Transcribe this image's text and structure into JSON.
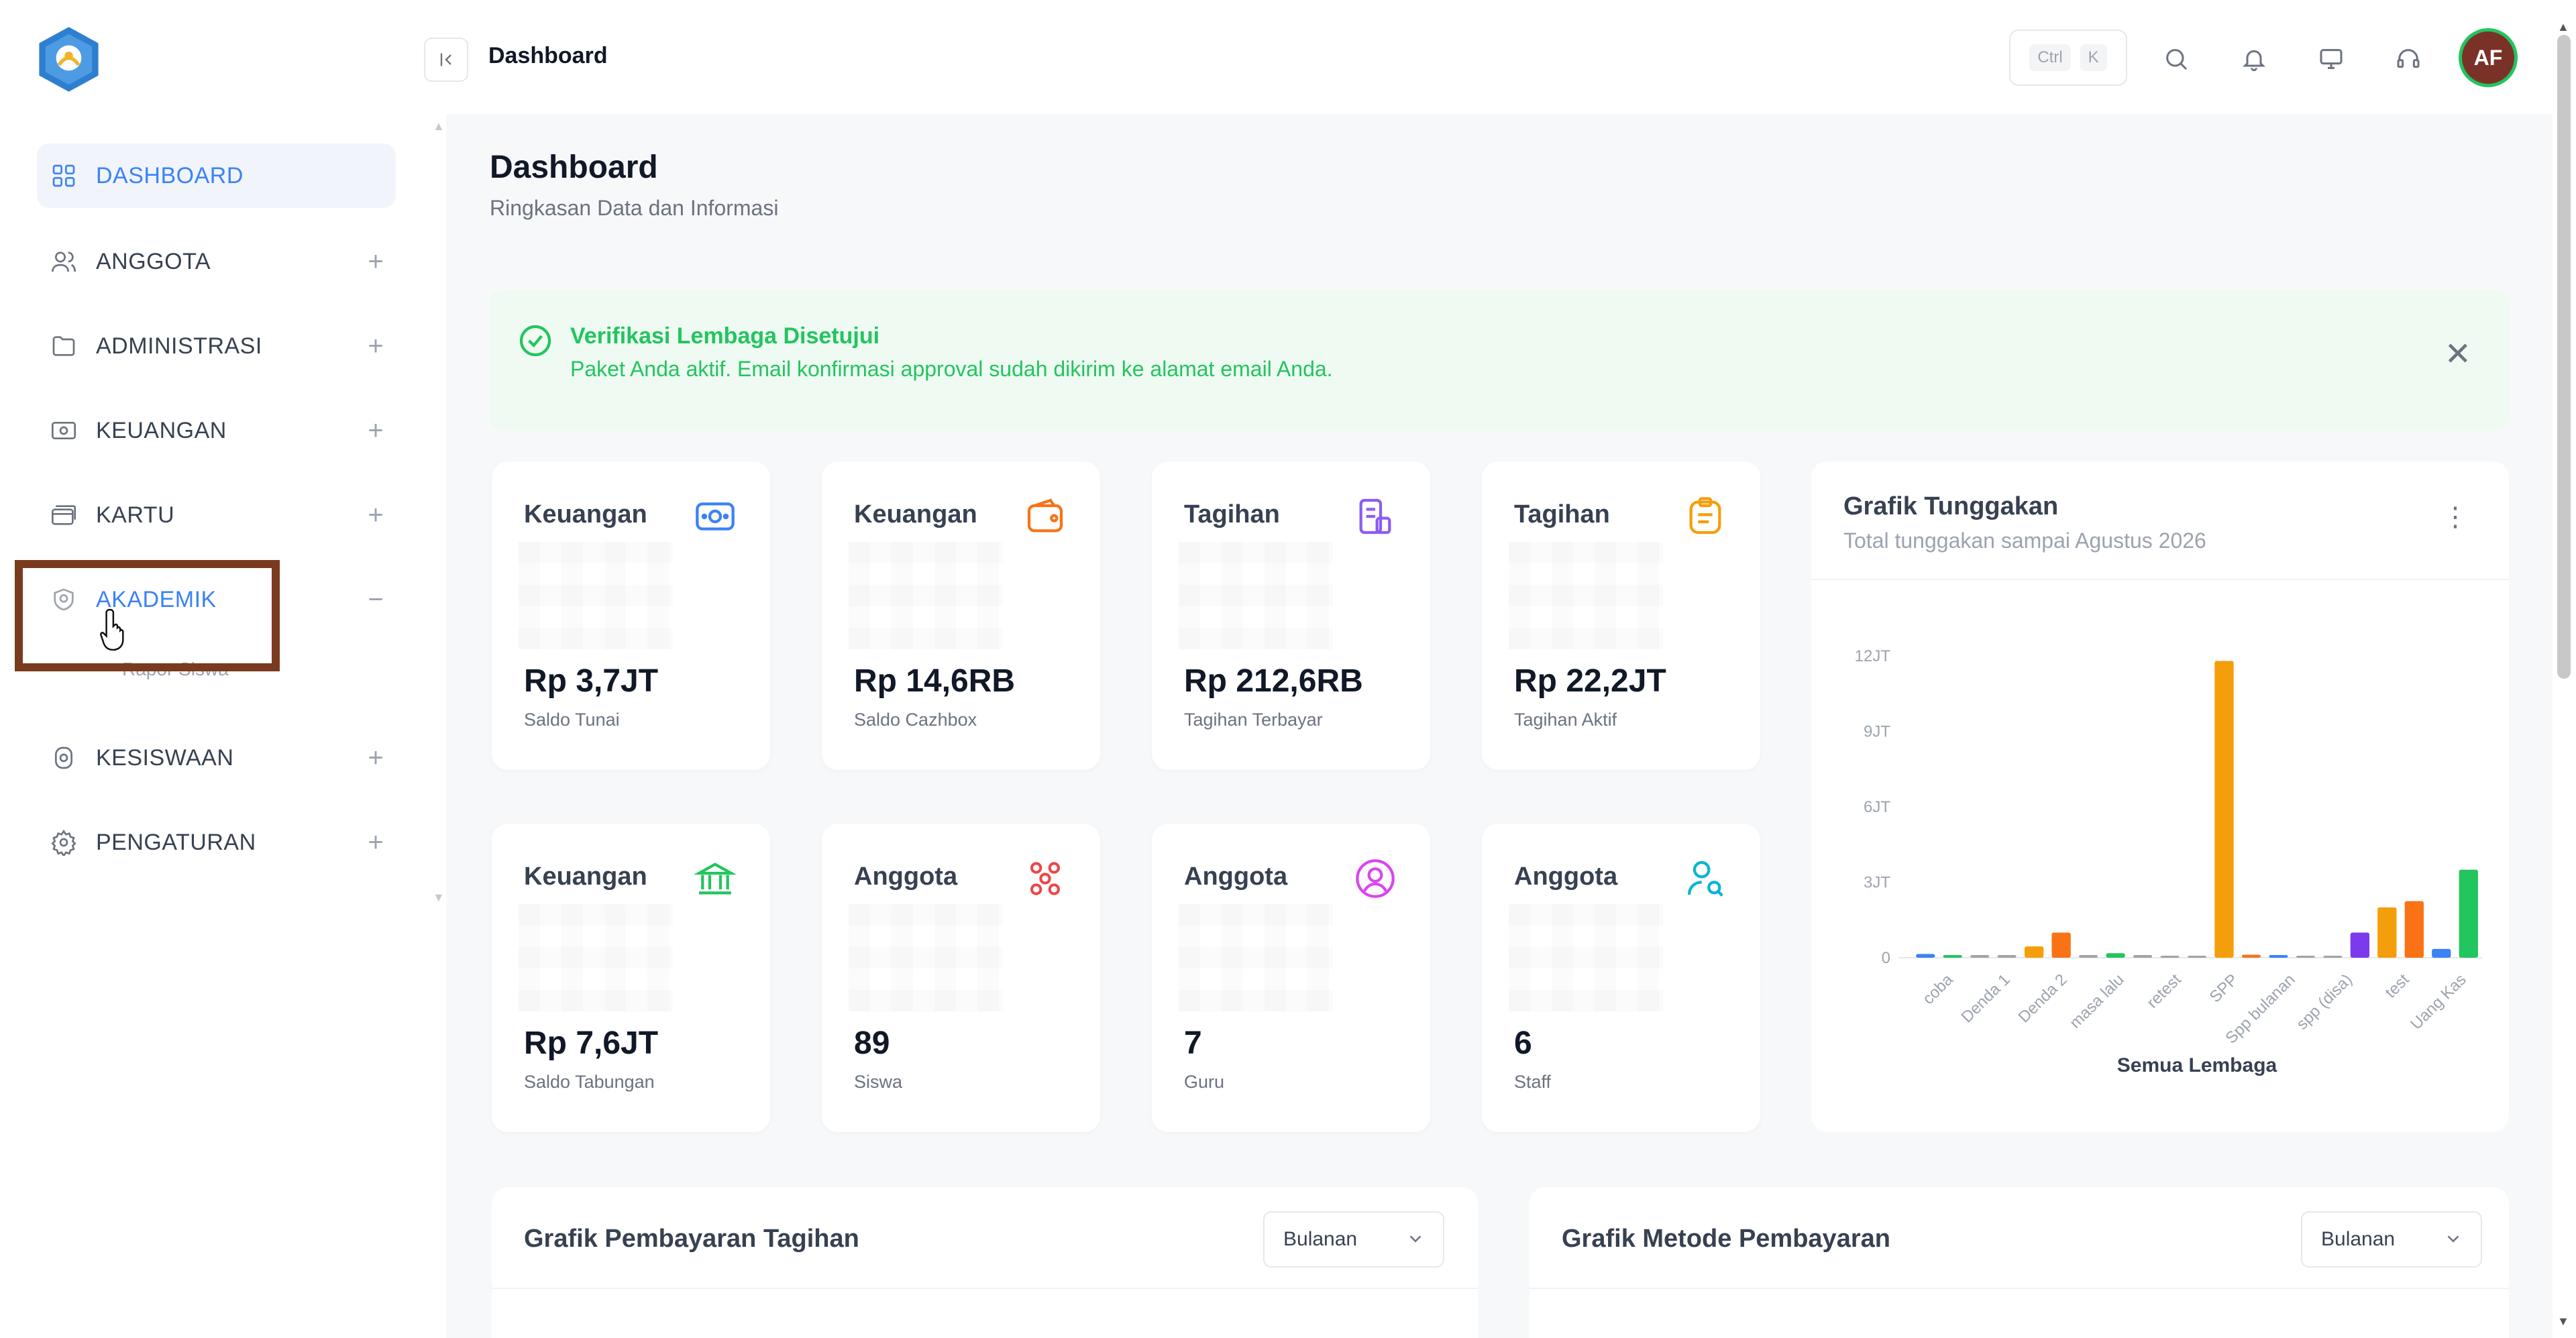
{
  "topbar": {
    "title": "Dashboard",
    "kbd_ctrl": "Ctrl",
    "kbd_k": "K",
    "avatar_initials": "AF"
  },
  "sidebar": {
    "items": [
      {
        "label": "DASHBOARD",
        "icon": "grid-icon",
        "toggle": ""
      },
      {
        "label": "ANGGOTA",
        "icon": "users-icon",
        "toggle": "+"
      },
      {
        "label": "ADMINISTRASI",
        "icon": "folder-icon",
        "toggle": "+"
      },
      {
        "label": "KEUANGAN",
        "icon": "money-icon",
        "toggle": "+"
      },
      {
        "label": "KARTU",
        "icon": "card-icon",
        "toggle": "+"
      },
      {
        "label": "AKADEMIK",
        "icon": "shield-icon",
        "toggle": "−"
      },
      {
        "label": "KESISWAAN",
        "icon": "student-icon",
        "toggle": "+"
      },
      {
        "label": "PENGATURAN",
        "icon": "gear-icon",
        "toggle": "+"
      }
    ],
    "sub_peek": "Rapor Siswa"
  },
  "page": {
    "title": "Dashboard",
    "subtitle": "Ringkasan Data dan Informasi"
  },
  "alert": {
    "title": "Verifikasi Lembaga Disetujui",
    "message": "Paket Anda aktif. Email konfirmasi approval sudah dikirim ke alamat email Anda."
  },
  "cards": [
    {
      "label": "Keuangan",
      "value": "Rp 3,7JT",
      "caption": "Saldo Tunai",
      "icon": "money-icon",
      "color": "#3b82f6"
    },
    {
      "label": "Keuangan",
      "value": "Rp 14,6RB",
      "caption": "Saldo Cazhbox",
      "icon": "wallet-icon",
      "color": "#f97316"
    },
    {
      "label": "Tagihan",
      "value": "Rp 212,6RB",
      "caption": "Tagihan Terbayar",
      "icon": "invoice-icon",
      "color": "#8b5cf6"
    },
    {
      "label": "Tagihan",
      "value": "Rp 22,2JT",
      "caption": "Tagihan Aktif",
      "icon": "clipboard-icon",
      "color": "#f59e0b"
    },
    {
      "label": "Keuangan",
      "value": "Rp 7,6JT",
      "caption": "Saldo Tabungan",
      "icon": "bank-icon",
      "color": "#22c55e"
    },
    {
      "label": "Anggota",
      "value": "89",
      "caption": "Siswa",
      "icon": "group-icon",
      "color": "#ef4444"
    },
    {
      "label": "Anggota",
      "value": "7",
      "caption": "Guru",
      "icon": "user-circle-icon",
      "color": "#d946ef"
    },
    {
      "label": "Anggota",
      "value": "6",
      "caption": "Staff",
      "icon": "user-search-icon",
      "color": "#06b6d4"
    }
  ],
  "tunggakan": {
    "title": "Grafik Tunggakan",
    "subtitle": "Total tunggakan sampai Agustus 2026",
    "xlabel": "Semua Lembaga"
  },
  "chart_data": {
    "type": "bar",
    "title": "Grafik Tunggakan",
    "subtitle": "Total tunggakan sampai Agustus 2026",
    "xlabel": "Semua Lembaga",
    "ylabel": "",
    "ylim": [
      0,
      12000000
    ],
    "yticks": [
      "0",
      "3JT",
      "6JT",
      "9JT",
      "12JT"
    ],
    "yticks_values": [
      0,
      3000000,
      6000000,
      9000000,
      12000000
    ],
    "categories": [
      "coba",
      "Denda 1",
      "Denda 2",
      "masa lalu",
      "retest",
      "SPP",
      "Spp bulanan",
      "spp (disa)",
      "test",
      "Uang Kas"
    ],
    "bars": [
      {
        "value": 150000,
        "color": "#3b82f6"
      },
      {
        "value": 100000,
        "color": "#22c55e"
      },
      {
        "value": 60000,
        "color": "#a3a3a3"
      },
      {
        "value": 60000,
        "color": "#a3a3a3"
      },
      {
        "value": 450000,
        "color": "#f59e0b"
      },
      {
        "value": 1000000,
        "color": "#f97316"
      },
      {
        "value": 30000,
        "color": "#a3a3a3"
      },
      {
        "value": 180000,
        "color": "#22c55e"
      },
      {
        "value": 30000,
        "color": "#a3a3a3"
      },
      {
        "value": 0,
        "color": "#a3a3a3"
      },
      {
        "value": 0,
        "color": "#a3a3a3"
      },
      {
        "value": 11800000,
        "color": "#f59e0b"
      },
      {
        "value": 120000,
        "color": "#f97316"
      },
      {
        "value": 90000,
        "color": "#3b82f6"
      },
      {
        "value": 0,
        "color": "#a3a3a3"
      },
      {
        "value": 0,
        "color": "#a3a3a3"
      },
      {
        "value": 1000000,
        "color": "#7c3aed"
      },
      {
        "value": 2000000,
        "color": "#f59e0b"
      },
      {
        "value": 2250000,
        "color": "#f97316"
      },
      {
        "value": 350000,
        "color": "#3b82f6"
      },
      {
        "value": 3500000,
        "color": "#22c55e"
      }
    ],
    "grid": false,
    "legend": "none"
  },
  "bottom": {
    "left_title": "Grafik Pembayaran Tagihan",
    "left_select": "Bulanan",
    "right_title": "Grafik Metode Pembayaran",
    "right_select": "Bulanan"
  }
}
